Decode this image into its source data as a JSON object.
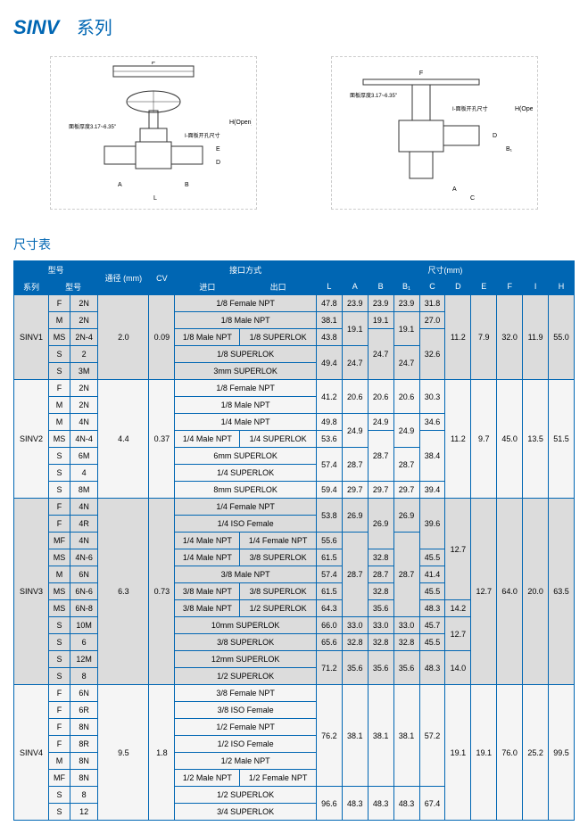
{
  "header": {
    "brand": "SINV",
    "series": "系列"
  },
  "dim_title": "尺寸表",
  "table": {
    "headers": {
      "model_group": "型号",
      "series": "系列",
      "model": "型号",
      "bore": "通径 (mm)",
      "cv": "CV",
      "conn_group": "接口方式",
      "inlet": "进口",
      "outlet": "出口",
      "dim_group": "尺寸(mm)",
      "L": "L",
      "A": "A",
      "B": "B",
      "B1": "B₁",
      "C": "C",
      "D": "D",
      "E": "E",
      "F": "F",
      "I": "I",
      "H": "H"
    }
  },
  "chart_data": {
    "type": "table",
    "title": "SINV 系列 尺寸表",
    "columns": [
      "系列",
      "型号1",
      "型号2",
      "通径(mm)",
      "CV",
      "进口",
      "出口",
      "L",
      "A",
      "B",
      "B1",
      "C",
      "D",
      "E",
      "F",
      "I",
      "H"
    ],
    "rows": [
      [
        "SINV1",
        "F",
        "2N",
        "2.0",
        "0.09",
        "1/8 Female NPT",
        "",
        "47.8",
        "23.9",
        "23.9",
        "23.9",
        "31.8",
        "11.2",
        "7.9",
        "32.0",
        "11.9",
        "55.0"
      ],
      [
        "SINV1",
        "M",
        "2N",
        "2.0",
        "0.09",
        "1/8 Male NPT",
        "",
        "38.1",
        "19.1",
        "19.1",
        "19.1",
        "27.0",
        "11.2",
        "7.9",
        "32.0",
        "11.9",
        "55.0"
      ],
      [
        "SINV1",
        "MS",
        "2N-4",
        "2.0",
        "0.09",
        "1/8 Male NPT",
        "1/8 SUPERLOK",
        "43.8",
        "19.1",
        "24.7",
        "19.1",
        "32.6",
        "11.2",
        "7.9",
        "32.0",
        "11.9",
        "55.0"
      ],
      [
        "SINV1",
        "S",
        "2",
        "2.0",
        "0.09",
        "1/8 SUPERLOK",
        "",
        "49.4",
        "24.7",
        "24.7",
        "24.7",
        "32.6",
        "11.2",
        "7.9",
        "32.0",
        "11.9",
        "55.0"
      ],
      [
        "SINV1",
        "S",
        "3M",
        "2.0",
        "0.09",
        "3mm SUPERLOK",
        "",
        "49.4",
        "24.7",
        "24.7",
        "24.7",
        "32.6",
        "11.2",
        "7.9",
        "32.0",
        "11.9",
        "55.0"
      ],
      [
        "SINV2",
        "F",
        "2N",
        "4.4",
        "0.37",
        "1/8 Female NPT",
        "",
        "41.2",
        "20.6",
        "20.6",
        "20.6",
        "30.3",
        "11.2",
        "9.7",
        "45.0",
        "13.5",
        "51.5"
      ],
      [
        "SINV2",
        "M",
        "2N",
        "4.4",
        "0.37",
        "1/8 Male NPT",
        "",
        "41.2",
        "20.6",
        "20.6",
        "20.6",
        "30.3",
        "11.2",
        "9.7",
        "45.0",
        "13.5",
        "51.5"
      ],
      [
        "SINV2",
        "M",
        "4N",
        "4.4",
        "0.37",
        "1/4 Male NPT",
        "",
        "49.8",
        "24.9",
        "24.9",
        "24.9",
        "34.6",
        "11.2",
        "9.7",
        "45.0",
        "13.5",
        "51.5"
      ],
      [
        "SINV2",
        "MS",
        "4N-4",
        "4.4",
        "0.37",
        "1/4 Male NPT",
        "1/4 SUPERLOK",
        "53.6",
        "24.9",
        "28.7",
        "24.9",
        "38.4",
        "11.2",
        "9.7",
        "45.0",
        "13.5",
        "51.5"
      ],
      [
        "SINV2",
        "S",
        "6M",
        "4.4",
        "0.37",
        "6mm SUPERLOK",
        "",
        "57.4",
        "28.7",
        "28.7",
        "28.7",
        "38.4",
        "11.2",
        "9.7",
        "45.0",
        "13.5",
        "51.5"
      ],
      [
        "SINV2",
        "S",
        "4",
        "4.4",
        "0.37",
        "1/4 SUPERLOK",
        "",
        "57.4",
        "28.7",
        "28.7",
        "28.7",
        "38.4",
        "11.2",
        "9.7",
        "45.0",
        "13.5",
        "51.5"
      ],
      [
        "SINV2",
        "S",
        "8M",
        "4.4",
        "0.37",
        "8mm SUPERLOK",
        "",
        "59.4",
        "29.7",
        "29.7",
        "29.7",
        "39.4",
        "11.2",
        "9.7",
        "45.0",
        "13.5",
        "51.5"
      ],
      [
        "SINV3",
        "F",
        "4N",
        "6.3",
        "0.73",
        "1/4 Female NPT",
        "",
        "53.8",
        "26.9",
        "26.9",
        "26.9",
        "39.6",
        "12.7",
        "12.7",
        "64.0",
        "20.0",
        "63.5"
      ],
      [
        "SINV3",
        "F",
        "4R",
        "6.3",
        "0.73",
        "1/4 ISO Female",
        "",
        "53.8",
        "26.9",
        "26.9",
        "26.9",
        "39.6",
        "12.7",
        "12.7",
        "64.0",
        "20.0",
        "63.5"
      ],
      [
        "SINV3",
        "MF",
        "4N",
        "6.3",
        "0.73",
        "1/4 Male NPT",
        "1/4 Female NPT",
        "55.6",
        "28.7",
        "26.9",
        "28.7",
        "39.6",
        "12.7",
        "12.7",
        "64.0",
        "20.0",
        "63.5"
      ],
      [
        "SINV3",
        "MS",
        "4N-6",
        "6.3",
        "0.73",
        "1/4 Male NPT",
        "3/8 SUPERLOK",
        "61.5",
        "28.7",
        "32.8",
        "28.7",
        "45.5",
        "12.7",
        "12.7",
        "64.0",
        "20.0",
        "63.5"
      ],
      [
        "SINV3",
        "M",
        "6N",
        "6.3",
        "0.73",
        "3/8 Male NPT",
        "",
        "57.4",
        "28.7",
        "28.7",
        "28.7",
        "41.4",
        "12.7",
        "12.7",
        "64.0",
        "20.0",
        "63.5"
      ],
      [
        "SINV3",
        "MS",
        "6N-6",
        "6.3",
        "0.73",
        "3/8 Male NPT",
        "3/8 SUPERLOK",
        "61.5",
        "28.7",
        "32.8",
        "28.7",
        "45.5",
        "12.7",
        "12.7",
        "64.0",
        "20.0",
        "63.5"
      ],
      [
        "SINV3",
        "MS",
        "6N-8",
        "6.3",
        "0.73",
        "3/8 Male NPT",
        "1/2 SUPERLOK",
        "64.3",
        "28.7",
        "35.6",
        "28.7",
        "48.3",
        "14.2",
        "12.7",
        "64.0",
        "20.0",
        "63.5"
      ],
      [
        "SINV3",
        "S",
        "10M",
        "6.3",
        "0.73",
        "10mm SUPERLOK",
        "",
        "66.0",
        "33.0",
        "33.0",
        "33.0",
        "45.7",
        "12.7",
        "12.7",
        "64.0",
        "20.0",
        "63.5"
      ],
      [
        "SINV3",
        "S",
        "6",
        "6.3",
        "0.73",
        "3/8 SUPERLOK",
        "",
        "65.6",
        "32.8",
        "32.8",
        "32.8",
        "45.5",
        "12.7",
        "12.7",
        "64.0",
        "20.0",
        "63.5"
      ],
      [
        "SINV3",
        "S",
        "12M",
        "6.3",
        "0.73",
        "12mm SUPERLOK",
        "",
        "71.2",
        "35.6",
        "35.6",
        "35.6",
        "48.3",
        "14.0",
        "12.7",
        "64.0",
        "20.0",
        "63.5"
      ],
      [
        "SINV3",
        "S",
        "8",
        "6.3",
        "0.73",
        "1/2 SUPERLOK",
        "",
        "71.2",
        "35.6",
        "35.6",
        "35.6",
        "48.3",
        "14.0",
        "12.7",
        "64.0",
        "20.0",
        "63.5"
      ],
      [
        "SINV4",
        "F",
        "6N",
        "9.5",
        "1.8",
        "3/8 Female NPT",
        "",
        "76.2",
        "38.1",
        "38.1",
        "38.1",
        "57.2",
        "19.1",
        "19.1",
        "76.0",
        "25.2",
        "99.5"
      ],
      [
        "SINV4",
        "F",
        "6R",
        "9.5",
        "1.8",
        "3/8 ISO Female",
        "",
        "76.2",
        "38.1",
        "38.1",
        "38.1",
        "57.2",
        "19.1",
        "19.1",
        "76.0",
        "25.2",
        "99.5"
      ],
      [
        "SINV4",
        "F",
        "8N",
        "9.5",
        "1.8",
        "1/2 Female NPT",
        "",
        "76.2",
        "38.1",
        "38.1",
        "38.1",
        "57.2",
        "19.1",
        "19.1",
        "76.0",
        "25.2",
        "99.5"
      ],
      [
        "SINV4",
        "F",
        "8R",
        "9.5",
        "1.8",
        "1/2 ISO Female",
        "",
        "76.2",
        "38.1",
        "38.1",
        "38.1",
        "57.2",
        "19.1",
        "19.1",
        "76.0",
        "25.2",
        "99.5"
      ],
      [
        "SINV4",
        "M",
        "8N",
        "9.5",
        "1.8",
        "1/2 Male NPT",
        "",
        "76.2",
        "38.1",
        "38.1",
        "38.1",
        "57.2",
        "19.1",
        "19.1",
        "76.0",
        "25.2",
        "99.5"
      ],
      [
        "SINV4",
        "MF",
        "8N",
        "9.5",
        "1.8",
        "1/2 Male NPT",
        "1/2 Female NPT",
        "76.2",
        "38.1",
        "38.1",
        "38.1",
        "57.2",
        "19.1",
        "19.1",
        "76.0",
        "25.2",
        "99.5"
      ],
      [
        "SINV4",
        "S",
        "8",
        "9.5",
        "1.8",
        "1/2 SUPERLOK",
        "",
        "96.6",
        "48.3",
        "48.3",
        "48.3",
        "67.4",
        "19.1",
        "19.1",
        "76.0",
        "25.2",
        "99.5"
      ],
      [
        "SINV4",
        "S",
        "12",
        "9.5",
        "1.8",
        "3/4 SUPERLOK",
        "",
        "96.6",
        "48.3",
        "48.3",
        "48.3",
        "67.4",
        "19.1",
        "19.1",
        "76.0",
        "25.2",
        "99.5"
      ]
    ]
  },
  "diagram_notes": {
    "note1": "面板厚度3.17~6.35\"",
    "note2": "I-面板开孔尺寸"
  }
}
